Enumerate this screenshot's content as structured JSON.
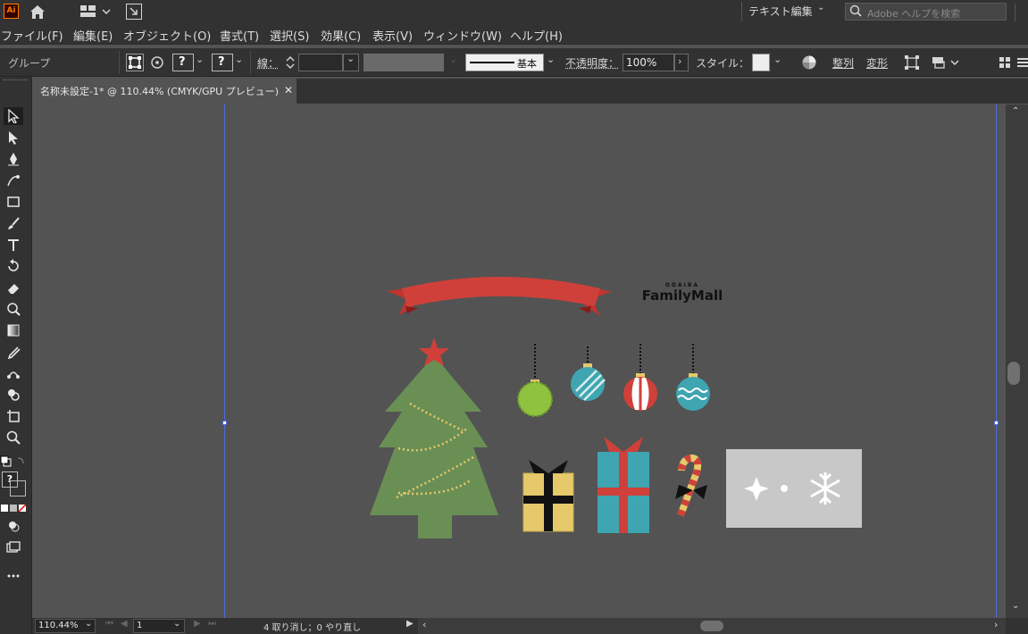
{
  "app": {
    "logo": "Ai",
    "workspace_label": "テキスト編集",
    "search_placeholder": "Adobe ヘルプを検索"
  },
  "menu": [
    "ファイル(F)",
    "編集(E)",
    "オブジェクト(O)",
    "書式(T)",
    "選択(S)",
    "効果(C)",
    "表示(V)",
    "ウィンドウ(W)",
    "ヘルプ(H)"
  ],
  "control": {
    "selection_type": "グループ",
    "stroke_label": "線：",
    "stroke_profile": "基本",
    "opacity_label": "不透明度：",
    "opacity_value": "100%",
    "style_label": "スタイル：",
    "align_label": "整列",
    "transform_label": "変形",
    "question_mark": "?"
  },
  "document": {
    "tab_title": "名称未設定-1* @ 110.44% (CMYK/GPU プレビュー)"
  },
  "artwork": {
    "brand_small": "ODAIBA",
    "brand_large": "FamilyMall"
  },
  "status": {
    "zoom": "110.44%",
    "artboard": "1",
    "undo_text": "4 取り消し；0 やり直し"
  },
  "colors": {
    "red": "#d0403a",
    "green": "#6a8f55",
    "teal": "#3fa5b0",
    "gold": "#e5c96a",
    "panel": "#c8c8c8"
  }
}
